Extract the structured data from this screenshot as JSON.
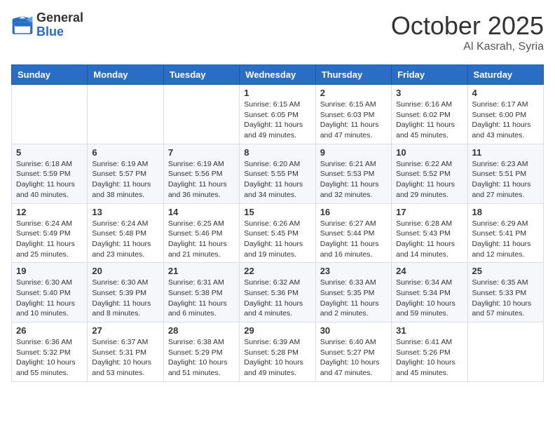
{
  "header": {
    "logo_general": "General",
    "logo_blue": "Blue",
    "month": "October 2025",
    "location": "Al Kasrah, Syria"
  },
  "weekdays": [
    "Sunday",
    "Monday",
    "Tuesday",
    "Wednesday",
    "Thursday",
    "Friday",
    "Saturday"
  ],
  "weeks": [
    [
      {
        "day": "",
        "info": ""
      },
      {
        "day": "",
        "info": ""
      },
      {
        "day": "",
        "info": ""
      },
      {
        "day": "1",
        "info": "Sunrise: 6:15 AM\nSunset: 6:05 PM\nDaylight: 11 hours\nand 49 minutes."
      },
      {
        "day": "2",
        "info": "Sunrise: 6:15 AM\nSunset: 6:03 PM\nDaylight: 11 hours\nand 47 minutes."
      },
      {
        "day": "3",
        "info": "Sunrise: 6:16 AM\nSunset: 6:02 PM\nDaylight: 11 hours\nand 45 minutes."
      },
      {
        "day": "4",
        "info": "Sunrise: 6:17 AM\nSunset: 6:00 PM\nDaylight: 11 hours\nand 43 minutes."
      }
    ],
    [
      {
        "day": "5",
        "info": "Sunrise: 6:18 AM\nSunset: 5:59 PM\nDaylight: 11 hours\nand 40 minutes."
      },
      {
        "day": "6",
        "info": "Sunrise: 6:19 AM\nSunset: 5:57 PM\nDaylight: 11 hours\nand 38 minutes."
      },
      {
        "day": "7",
        "info": "Sunrise: 6:19 AM\nSunset: 5:56 PM\nDaylight: 11 hours\nand 36 minutes."
      },
      {
        "day": "8",
        "info": "Sunrise: 6:20 AM\nSunset: 5:55 PM\nDaylight: 11 hours\nand 34 minutes."
      },
      {
        "day": "9",
        "info": "Sunrise: 6:21 AM\nSunset: 5:53 PM\nDaylight: 11 hours\nand 32 minutes."
      },
      {
        "day": "10",
        "info": "Sunrise: 6:22 AM\nSunset: 5:52 PM\nDaylight: 11 hours\nand 29 minutes."
      },
      {
        "day": "11",
        "info": "Sunrise: 6:23 AM\nSunset: 5:51 PM\nDaylight: 11 hours\nand 27 minutes."
      }
    ],
    [
      {
        "day": "12",
        "info": "Sunrise: 6:24 AM\nSunset: 5:49 PM\nDaylight: 11 hours\nand 25 minutes."
      },
      {
        "day": "13",
        "info": "Sunrise: 6:24 AM\nSunset: 5:48 PM\nDaylight: 11 hours\nand 23 minutes."
      },
      {
        "day": "14",
        "info": "Sunrise: 6:25 AM\nSunset: 5:46 PM\nDaylight: 11 hours\nand 21 minutes."
      },
      {
        "day": "15",
        "info": "Sunrise: 6:26 AM\nSunset: 5:45 PM\nDaylight: 11 hours\nand 19 minutes."
      },
      {
        "day": "16",
        "info": "Sunrise: 6:27 AM\nSunset: 5:44 PM\nDaylight: 11 hours\nand 16 minutes."
      },
      {
        "day": "17",
        "info": "Sunrise: 6:28 AM\nSunset: 5:43 PM\nDaylight: 11 hours\nand 14 minutes."
      },
      {
        "day": "18",
        "info": "Sunrise: 6:29 AM\nSunset: 5:41 PM\nDaylight: 11 hours\nand 12 minutes."
      }
    ],
    [
      {
        "day": "19",
        "info": "Sunrise: 6:30 AM\nSunset: 5:40 PM\nDaylight: 11 hours\nand 10 minutes."
      },
      {
        "day": "20",
        "info": "Sunrise: 6:30 AM\nSunset: 5:39 PM\nDaylight: 11 hours\nand 8 minutes."
      },
      {
        "day": "21",
        "info": "Sunrise: 6:31 AM\nSunset: 5:38 PM\nDaylight: 11 hours\nand 6 minutes."
      },
      {
        "day": "22",
        "info": "Sunrise: 6:32 AM\nSunset: 5:36 PM\nDaylight: 11 hours\nand 4 minutes."
      },
      {
        "day": "23",
        "info": "Sunrise: 6:33 AM\nSunset: 5:35 PM\nDaylight: 11 hours\nand 2 minutes."
      },
      {
        "day": "24",
        "info": "Sunrise: 6:34 AM\nSunset: 5:34 PM\nDaylight: 10 hours\nand 59 minutes."
      },
      {
        "day": "25",
        "info": "Sunrise: 6:35 AM\nSunset: 5:33 PM\nDaylight: 10 hours\nand 57 minutes."
      }
    ],
    [
      {
        "day": "26",
        "info": "Sunrise: 6:36 AM\nSunset: 5:32 PM\nDaylight: 10 hours\nand 55 minutes."
      },
      {
        "day": "27",
        "info": "Sunrise: 6:37 AM\nSunset: 5:31 PM\nDaylight: 10 hours\nand 53 minutes."
      },
      {
        "day": "28",
        "info": "Sunrise: 6:38 AM\nSunset: 5:29 PM\nDaylight: 10 hours\nand 51 minutes."
      },
      {
        "day": "29",
        "info": "Sunrise: 6:39 AM\nSunset: 5:28 PM\nDaylight: 10 hours\nand 49 minutes."
      },
      {
        "day": "30",
        "info": "Sunrise: 6:40 AM\nSunset: 5:27 PM\nDaylight: 10 hours\nand 47 minutes."
      },
      {
        "day": "31",
        "info": "Sunrise: 6:41 AM\nSunset: 5:26 PM\nDaylight: 10 hours\nand 45 minutes."
      },
      {
        "day": "",
        "info": ""
      }
    ]
  ]
}
